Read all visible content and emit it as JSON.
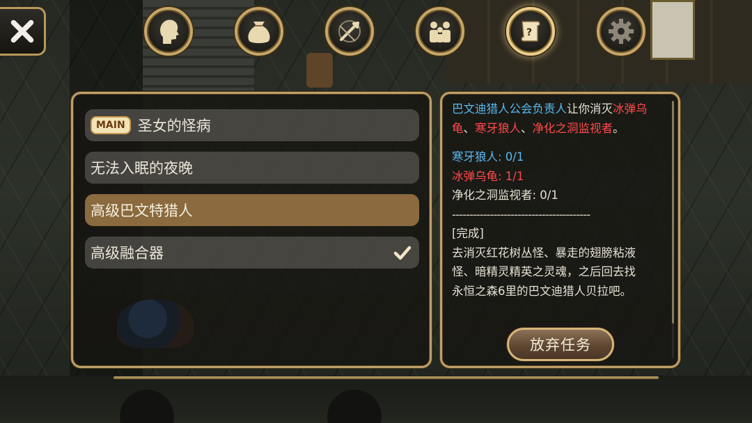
{
  "menu": {
    "close_icon": "close-x-icon",
    "tabs": [
      {
        "name": "character",
        "icon": "head-silhouette-icon",
        "active": false
      },
      {
        "name": "inventory",
        "icon": "bag-icon",
        "active": false
      },
      {
        "name": "skills",
        "icon": "crossed-swords-icon",
        "active": false
      },
      {
        "name": "social",
        "icon": "people-icon",
        "active": false
      },
      {
        "name": "quests",
        "icon": "quest-scroll-icon",
        "active": true
      },
      {
        "name": "settings",
        "icon": "gear-icon",
        "active": false
      }
    ]
  },
  "quests": [
    {
      "badge": "MAIN",
      "title": "圣女的怪病",
      "selected": false,
      "completed": false
    },
    {
      "badge": "",
      "title": "无法入眠的夜晚",
      "selected": false,
      "completed": false
    },
    {
      "badge": "",
      "title": "高级巴文特猎人",
      "selected": true,
      "completed": false
    },
    {
      "badge": "",
      "title": "高级融合器",
      "selected": false,
      "completed": true
    }
  ],
  "detail": {
    "giver": "巴文迪猎人公会负责人",
    "intro_verb": "让你消灭",
    "targets": [
      "冰弹乌龟",
      "寒牙狼人",
      "净化之洞监视者"
    ],
    "sep1": "、",
    "sep2": "、",
    "end_punct": "。",
    "progress": [
      {
        "label": "寒牙狼人: 0/1",
        "color": "blue"
      },
      {
        "label": "冰弹乌龟: 1/1",
        "color": "red"
      },
      {
        "label": "净化之洞监视者: 0/1",
        "color": "white"
      }
    ],
    "divider": "----------------------------------------",
    "complete_header": "[完成]",
    "complete_lines": [
      "去消灭红花树丛怪、暴走的翅膀粘液",
      "怪、暗精灵精英之灵魂，之后回去找",
      "永恒之森6里的巴文迪猎人贝拉吧。"
    ],
    "abandon_label": "放弃任务"
  },
  "colors": {
    "frame_gold": "#bfa06a",
    "selected_row": "#8a6a3e",
    "npc_blue": "#59b9ef",
    "enemy_red": "#ff4a4a"
  }
}
